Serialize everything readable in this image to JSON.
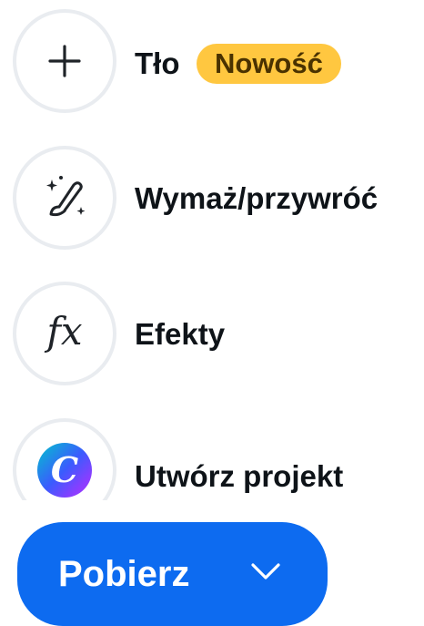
{
  "menu": {
    "items": [
      {
        "label": "Tło",
        "badge": "Nowość",
        "icon": "plus-icon"
      },
      {
        "label": "Wymaż/przywróć",
        "icon": "magic-brush-icon"
      },
      {
        "label": "Efekty",
        "icon": "fx-icon",
        "icon_glyph": "fx"
      },
      {
        "label": "Utwórz projekt",
        "icon": "canva-logo-icon",
        "icon_glyph": "C"
      }
    ]
  },
  "download": {
    "label": "Pobierz",
    "icon": "chevron-down-icon"
  },
  "colors": {
    "badge_bg": "#ffc740",
    "button_bg": "#0d6bf0",
    "icon_border": "#e9ecf0",
    "text": "#0e1318"
  }
}
